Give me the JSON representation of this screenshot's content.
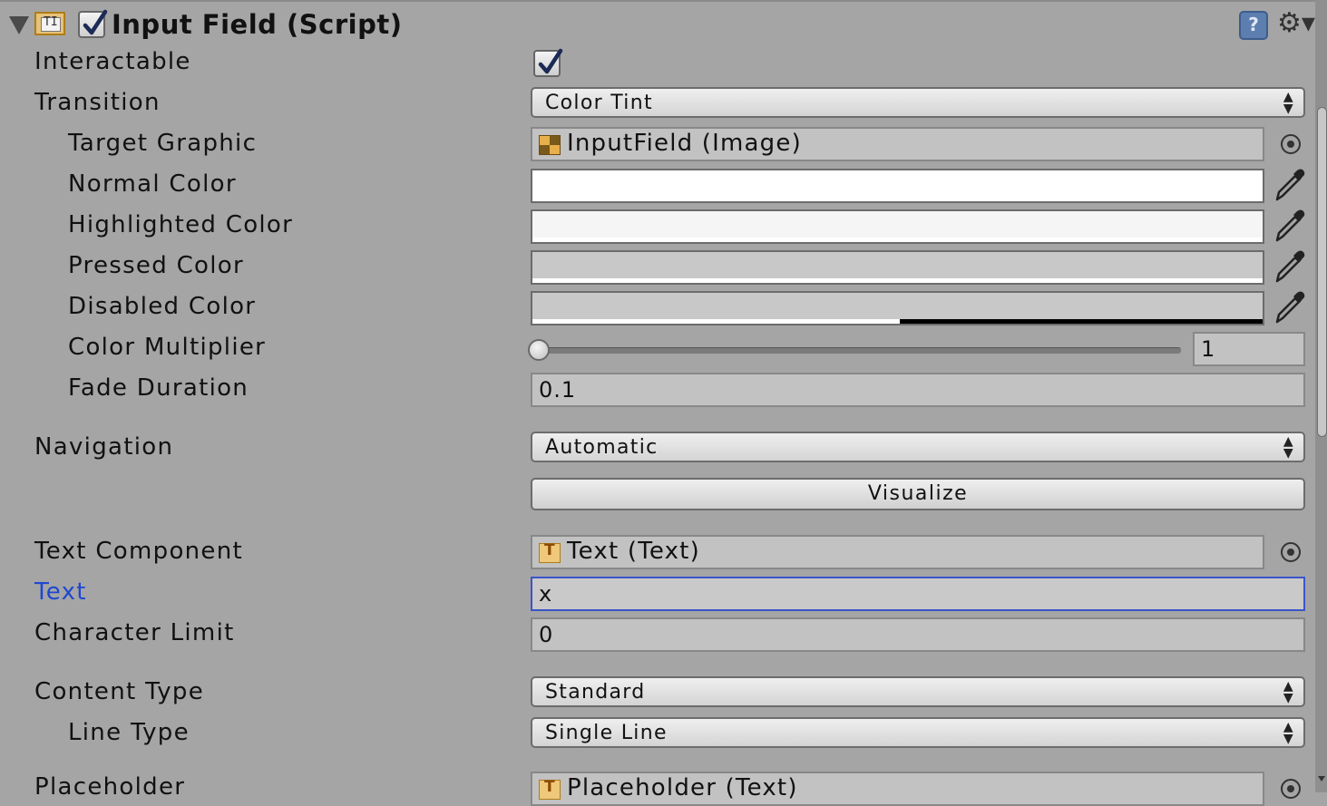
{
  "header": {
    "title": "Input Field (Script)",
    "script_icon_text": "TI",
    "help_icon": "?",
    "gear_icon": "⚙▾"
  },
  "fields": {
    "interactable": {
      "label": "Interactable",
      "checked": true
    },
    "transition": {
      "label": "Transition",
      "value": "Color Tint"
    },
    "target_graphic": {
      "label": "Target Graphic",
      "value": "InputField (Image)"
    },
    "normal_color": {
      "label": "Normal Color",
      "color": "#ffffff"
    },
    "highlighted_color": {
      "label": "Highlighted Color",
      "color": "#f5f5f5"
    },
    "pressed_color": {
      "label": "Pressed Color",
      "color": "#c8c8c8"
    },
    "disabled_color": {
      "label": "Disabled Color",
      "color": "#c8c8c8",
      "alpha": 0.5
    },
    "color_multiplier": {
      "label": "Color Multiplier",
      "value": "1"
    },
    "fade_duration": {
      "label": "Fade Duration",
      "value": "0.1"
    },
    "navigation": {
      "label": "Navigation",
      "value": "Automatic",
      "button": "Visualize"
    },
    "text_component": {
      "label": "Text Component",
      "value": "Text (Text)"
    },
    "text": {
      "label": "Text",
      "value": "x"
    },
    "character_limit": {
      "label": "Character Limit",
      "value": "0"
    },
    "content_type": {
      "label": "Content Type",
      "value": "Standard"
    },
    "line_type": {
      "label": "Line Type",
      "value": "Single Line"
    },
    "placeholder": {
      "label": "Placeholder",
      "value": "Placeholder (Text)"
    }
  }
}
